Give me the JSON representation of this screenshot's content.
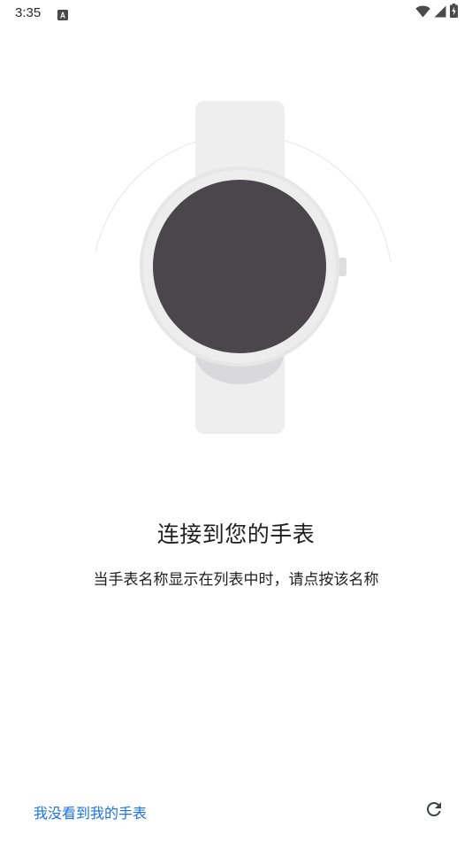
{
  "status_bar": {
    "time": "3:35",
    "notification_icon": "font-a-icon",
    "wifi_icon": "wifi-icon",
    "signal_icon": "cell-signal-icon",
    "battery_icon": "battery-charging-icon"
  },
  "illustration": {
    "icon": "smartwatch-icon",
    "face_color": "#4b464b",
    "band_color": "#eeeeee"
  },
  "main": {
    "title": "连接到您的手表",
    "subtitle": "当手表名称显示在列表中时，请点按该名称"
  },
  "footer": {
    "not_found_link": "我没看到我的手表",
    "refresh_icon": "refresh-icon",
    "link_color": "#1a73e8"
  }
}
